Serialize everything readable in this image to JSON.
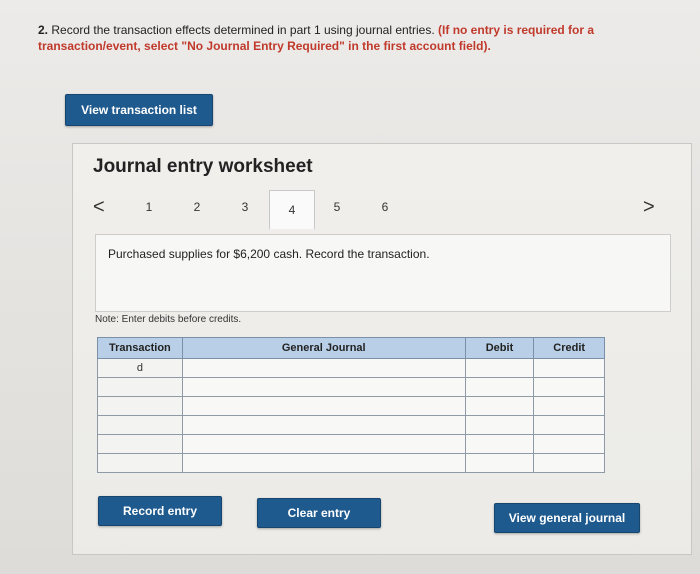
{
  "header": {
    "number": "2.",
    "instruction": "Record the transaction effects determined in part 1 using journal entries.",
    "warning": "(If no entry is required for a transaction/event, select \"No Journal Entry Required\" in the first account field)."
  },
  "buttons": {
    "view_transaction_list": "View transaction list",
    "record_entry": "Record entry",
    "clear_entry": "Clear entry",
    "view_general_journal": "View general journal"
  },
  "worksheet": {
    "title": "Journal entry worksheet",
    "tabs": [
      "1",
      "2",
      "3",
      "4",
      "5",
      "6"
    ],
    "active_tab": "4",
    "prev_arrow": "<",
    "next_arrow": ">",
    "description": "Purchased supplies for $6,200 cash. Record the transaction.",
    "note": "Note: Enter debits before credits."
  },
  "journal": {
    "columns": [
      "Transaction",
      "General Journal",
      "Debit",
      "Credit"
    ],
    "rows": [
      {
        "transaction": "d"
      },
      {
        "transaction": ""
      },
      {
        "transaction": ""
      },
      {
        "transaction": ""
      },
      {
        "transaction": ""
      },
      {
        "transaction": ""
      }
    ]
  },
  "colors": {
    "button_blue": "#1f5a8f",
    "header_blue": "#b8cfe7",
    "warning_red": "#c0392b"
  }
}
